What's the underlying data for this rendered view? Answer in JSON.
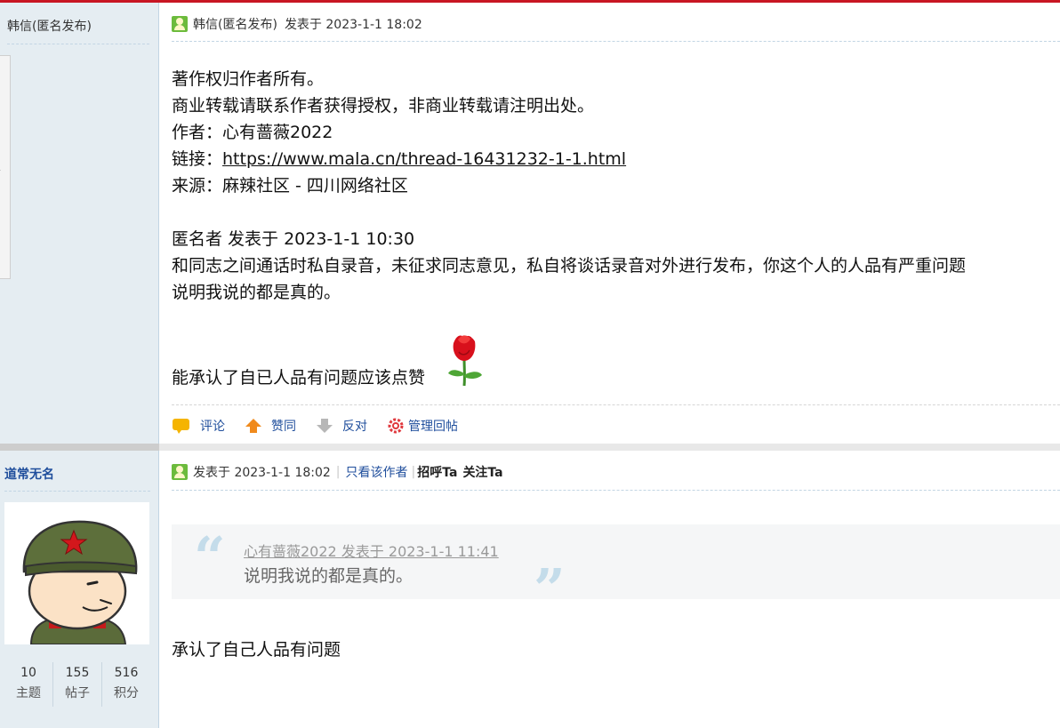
{
  "post1": {
    "sidebar_author": "韩信(匿名发布)",
    "header_author": "韩信(匿名发布)",
    "header_meta": "发表于 2023-1-1 18:02",
    "lines": [
      "著作权归作者所有。",
      "商业转载请联系作者获得授权，非商业转载请注明出处。",
      "作者：心有蔷薇2022"
    ],
    "link_label": "链接：",
    "link_url": "https://www.mala.cn/thread-16431232-1-1.html",
    "source_line": "来源：麻辣社区 - 四川网络社区",
    "quote_header": "匿名者 发表于 2023-1-1 10:30",
    "quote_line1": "和同志之间通话时私自录音，未征求同志意见，私自将谈话录音对外进行发布，你这个人的人品有严重问题",
    "quote_line2": "说明我说的都是真的。",
    "closing_text": "能承认了自已人品有问题应该点赞",
    "actions": {
      "comment": "评论",
      "support": "赞同",
      "oppose": "反对",
      "manage": "管理回帖"
    }
  },
  "post2": {
    "author": "道常无名",
    "header_meta": "发表于 2023-1-1 18:02",
    "view_author_only": "只看该作者",
    "greet": "招呼Ta",
    "follow": "关注Ta",
    "stats": [
      {
        "num": "10",
        "label": "主题"
      },
      {
        "num": "155",
        "label": "帖子"
      },
      {
        "num": "516",
        "label": "积分"
      }
    ],
    "quote_meta": "心有蔷薇2022 发表于 2023-1-1 11:41",
    "quote_text": "说明我说的都是真的。",
    "body": "承认了自己人品有问题"
  },
  "colors": {
    "accent_top": "#c81623",
    "link_blue": "#1f4e9c",
    "sidebar_bg": "#e5edf2"
  },
  "icons": [
    "user-icon",
    "comment-icon",
    "thumb-up-icon",
    "thumb-down-icon",
    "gear-icon",
    "rose-icon"
  ]
}
